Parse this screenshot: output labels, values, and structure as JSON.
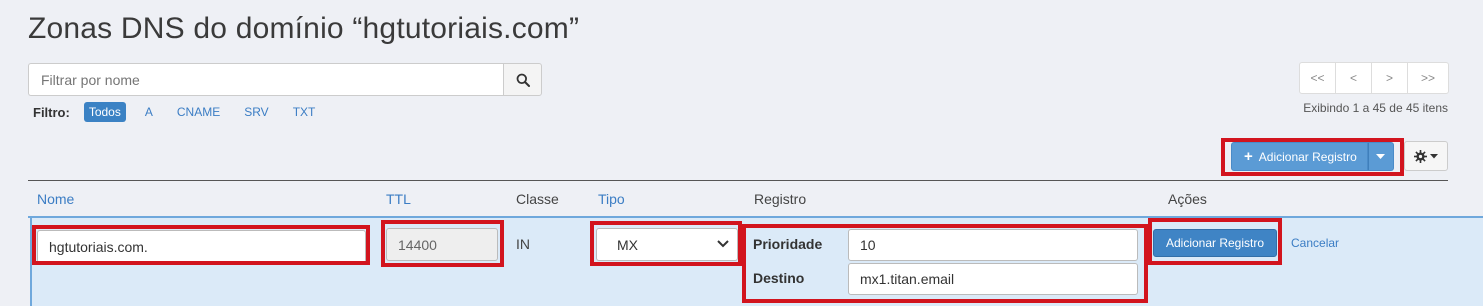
{
  "page_title": "Zonas DNS do domínio “hgtutoriais.com”",
  "search": {
    "placeholder": "Filtrar por nome",
    "icon": "search-icon"
  },
  "filter": {
    "label": "Filtro:",
    "options": [
      "Todos",
      "A",
      "CNAME",
      "SRV",
      "TXT"
    ],
    "active": "Todos"
  },
  "pagination": {
    "buttons": [
      "<<",
      "<",
      ">",
      ">>"
    ],
    "info": "Exibindo 1 a 45 de 45 itens"
  },
  "toolbar": {
    "add_label": "Adicionar Registro",
    "add_icon": "plus-icon",
    "caret_icon": "caret-down-icon",
    "settings_icon": "gear-icon"
  },
  "table": {
    "headers": {
      "nome": "Nome",
      "ttl": "TTL",
      "classe": "Classe",
      "tipo": "Tipo",
      "registro": "Registro",
      "acoes": "Ações"
    }
  },
  "edit_row": {
    "nome": "hgtutoriais.com.",
    "ttl": "14400",
    "classe": "IN",
    "tipo": "MX",
    "prioridade_label": "Prioridade",
    "prioridade_value": "10",
    "destino_label": "Destino",
    "destino_value": "mx1.titan.email",
    "save_label": "Adicionar Registro",
    "cancel_label": "Cancelar"
  },
  "colors": {
    "accent": "#3b82c4",
    "highlight_box": "#d2141e",
    "row_bg": "#dbeaf8",
    "page_bg": "#eef0f5"
  }
}
